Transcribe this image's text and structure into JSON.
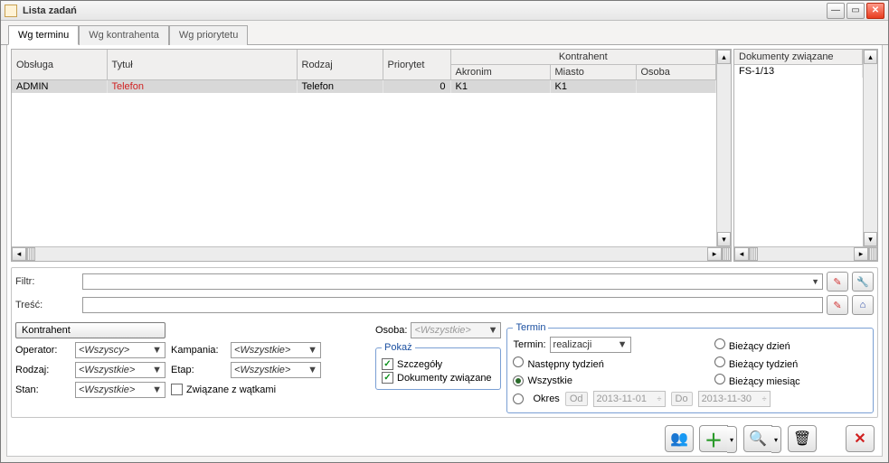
{
  "window": {
    "title": "Lista zadań"
  },
  "tabs": [
    "Wg terminu",
    "Wg kontrahenta",
    "Wg priorytetu"
  ],
  "active_tab": 0,
  "main_grid": {
    "group_header": "Kontrahent",
    "columns": [
      "Obsługa",
      "Tytuł",
      "Rodzaj",
      "Priorytet",
      "Akronim",
      "Miasto",
      "Osoba"
    ],
    "rows": [
      {
        "obsluga": "ADMIN",
        "tytul": "Telefon",
        "rodzaj": "Telefon",
        "priorytet": "0",
        "akronim": "K1",
        "miasto": "K1",
        "osoba": ""
      }
    ]
  },
  "side_grid": {
    "header": "Dokumenty związane",
    "rows": [
      "FS-1/13"
    ]
  },
  "filters": {
    "filtr_label": "Filtr:",
    "tresc_label": "Treść:"
  },
  "kontrahent_btn": "Kontrahent",
  "selects": {
    "operator_label": "Operator:",
    "operator_value": "<Wszyscy>",
    "rodzaj_label": "Rodzaj:",
    "rodzaj_value": "<Wszystkie>",
    "stan_label": "Stan:",
    "stan_value": "<Wszystkie>",
    "kampania_label": "Kampania:",
    "kampania_value": "<Wszystkie>",
    "etap_label": "Etap:",
    "etap_value": "<Wszystkie>",
    "zwiazane_label": "Związane z wątkami",
    "osoba_label": "Osoba:",
    "osoba_value": "<Wszystkie>"
  },
  "pokaz": {
    "legend": "Pokaż",
    "szczegoly": "Szczegóły",
    "dokumenty": "Dokumenty związane"
  },
  "termin": {
    "legend": "Termin",
    "termin_label": "Termin:",
    "termin_value": "realizacji",
    "opts": {
      "biezacy_dzien": "Bieżący dzień",
      "nastepny_tydzien": "Następny tydzień",
      "biezacy_tydzien": "Bieżący tydzień",
      "wszystkie": "Wszystkie",
      "biezacy_miesiac": "Bieżący miesiąc",
      "okres": "Okres"
    },
    "od_label": "Od",
    "od_value": "2013-11-01",
    "do_label": "Do",
    "do_value": "2013-11-30"
  }
}
